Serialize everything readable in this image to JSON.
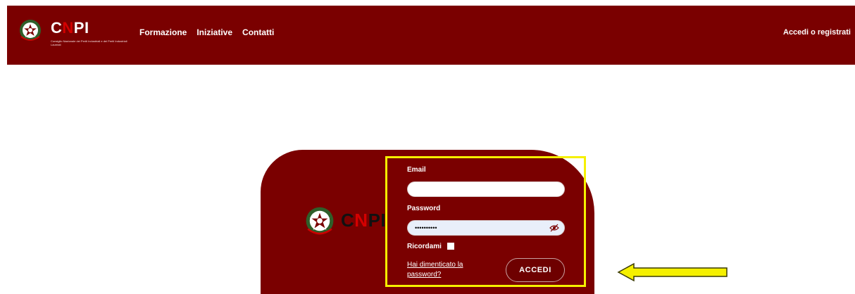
{
  "header": {
    "brand": {
      "name_c": "C",
      "name_n": "N",
      "name_pi": "PI",
      "tagline": "Consiglio Nazionale dei Periti Industriali e dei Periti Industriali Laureati"
    },
    "nav": [
      "Formazione",
      "Iniziative",
      "Contatti"
    ],
    "login_link": "Accedi o registrati"
  },
  "login": {
    "logo": {
      "c": "C",
      "n": "N",
      "pi": "PI"
    },
    "email_label": "Email",
    "email_value": "",
    "password_label": "Password",
    "password_value": "••••••••••",
    "remember_label": "Ricordami",
    "forgot_link": "Hai dimenticato la password?",
    "submit_label": "ACCEDI"
  },
  "colors": {
    "brand": "#7a0000",
    "accent": "#d40000",
    "highlight": "#f5f000",
    "field_bg": "#e9effa"
  },
  "icons": [
    "emblem-icon",
    "eye-slash-icon",
    "arrow-left-icon"
  ]
}
